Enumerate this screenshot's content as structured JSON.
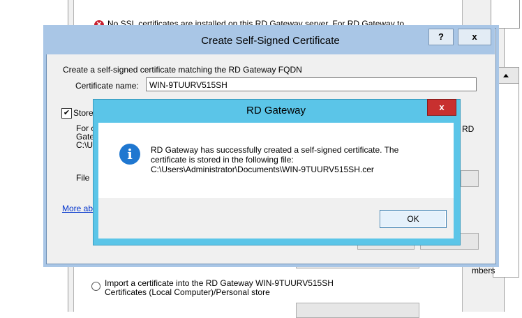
{
  "background": {
    "warning_text": "No SSL certificates are installed on this RD Gateway server. For RD Gateway to",
    "import_line1": "Import a certificate into the RD Gateway WIN-9TUURV515SH",
    "import_line2": "Certificates (Local Computer)/Personal store",
    "partial_text": "mbers"
  },
  "dialog": {
    "title": "Create Self-Signed Certificate",
    "help_label": "?",
    "close_label": "x",
    "description": "Create a self-signed certificate matching the RD Gateway FQDN",
    "cert_name_label": "Certificate name:",
    "cert_name_value": "WIN-9TUURV515SH",
    "store_checkbox_checked": true,
    "store_label": "Store",
    "for_text_1": "For c",
    "for_text_2": "Gate",
    "for_text_3": "C:\\U",
    "rd_text": "RD",
    "file_label": "File",
    "more_link": "More ab"
  },
  "messagebox": {
    "title": "RD Gateway",
    "close_label": "x",
    "icon": "info-icon",
    "message_line1": "RD Gateway has successfully created a self-signed certificate. The",
    "message_line2": "certificate is stored in the following file:",
    "message_line3": "C:\\Users\\Administrator\\Documents\\WIN-9TUURV515SH.cer",
    "ok_label": "OK"
  },
  "colors": {
    "messagebox_frame": "#5bc5e8",
    "dialog_frame": "#a9c6e6",
    "close_red": "#c8302f",
    "info_blue": "#1f77d0"
  }
}
